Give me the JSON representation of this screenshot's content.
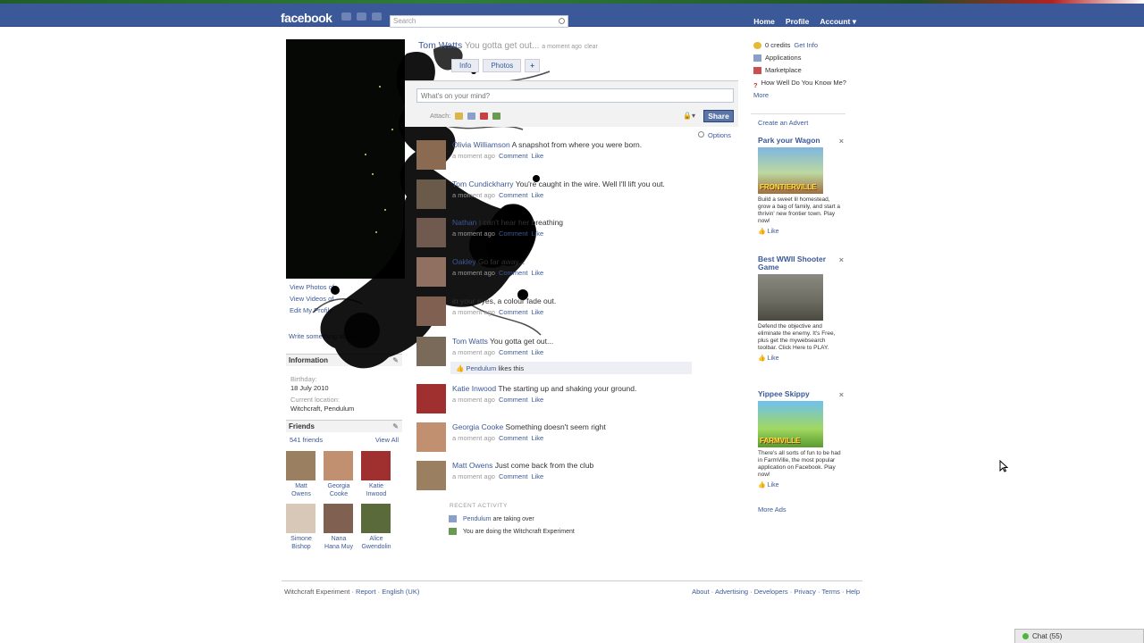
{
  "brand": {
    "logo": "facebook"
  },
  "header": {
    "search_placeholder": "Search",
    "nav": [
      "Home",
      "Profile",
      "Account ▾"
    ]
  },
  "colors": {
    "brand_blue": "#3b5998",
    "link": "#3b5998",
    "share": "#5b74a8"
  },
  "profile": {
    "name": "Tom Watts",
    "status": "You gotta get out...",
    "status_time": "a moment ago",
    "clear": "clear",
    "tabs": [
      "Info",
      "Photos",
      "+"
    ]
  },
  "left": {
    "links": [
      "View Photos of",
      "View Videos of",
      "Edit My Profile"
    ],
    "write_about": "Write something about",
    "info_title": "Information",
    "birthday_label": "Birthday:",
    "birthday": "18 July 2010",
    "location_label": "Current location:",
    "location": "Witchcraft, Pendulum",
    "friends_title": "Friends",
    "friends_count": "541 friends",
    "view_all": "View All",
    "friends": [
      {
        "first": "Matt",
        "last": "Owens",
        "color": "#9a8060"
      },
      {
        "first": "Georgia",
        "last": "Cooke",
        "color": "#c09070"
      },
      {
        "first": "Katie",
        "last": "Inwood",
        "color": "#a03030"
      },
      {
        "first": "Simone",
        "last": "Bishop",
        "color": "#d8c8b8"
      },
      {
        "first": "Nana",
        "last": "Hana Muy",
        "color": "#806050"
      },
      {
        "first": "Alice",
        "last": "Gwendolin",
        "color": "#5a6a3a"
      }
    ]
  },
  "composer": {
    "placeholder": "What's on your mind?",
    "attach_label": "Attach:",
    "share": "Share",
    "options": "Options"
  },
  "feed": [
    {
      "who": "Olivia Williamson",
      "text": "A snapshot from where you were born.",
      "color": "#8a6a50"
    },
    {
      "who": "Tom Cundickharry",
      "text": "You're caught in the wire. Well I'll lift you out.",
      "color": "#6a5a4a"
    },
    {
      "who": "Nathan",
      "text": "I can't hear her breathing",
      "color": "#705a50"
    },
    {
      "who": "Oakley",
      "text": "Go far away...",
      "color": "#907060"
    },
    {
      "who": "",
      "text": "in your eyes, a colour fade out.",
      "color": "#806050"
    },
    {
      "who": "Tom Watts",
      "text": "You gotta get out...",
      "color": "#7a6a5a"
    },
    {
      "who": "Katie Inwood",
      "text": "The starting up and shaking your ground.",
      "color": "#a03030"
    },
    {
      "who": "Georgia Cooke",
      "text": "Something doesn't seem right",
      "color": "#c09070"
    },
    {
      "who": "Matt Owens",
      "text": "Just come back from the club",
      "color": "#9a8060"
    }
  ],
  "feed_meta": {
    "time": "a moment ago",
    "comment": "Comment",
    "like": "Like"
  },
  "likes_bar": {
    "who": "Pendulum",
    "text": "likes this"
  },
  "recent": {
    "title": "RECENT ACTIVITY",
    "items": [
      {
        "who": "Pendulum",
        "text": "are taking over"
      },
      {
        "who": "",
        "text": "You are doing the Witchcraft Experiment"
      }
    ]
  },
  "right": {
    "credits": "0 credits",
    "get_info": "Get Info",
    "applications": "Applications",
    "marketplace": "Marketplace",
    "quiz": "How Well Do You Know Me?",
    "more": "More",
    "create_advert": "Create an Advert",
    "ads": [
      {
        "title": "Park your Wagon",
        "body": "Build a sweet lil homestead, grow a bag of family, and start a thrivin' new frontier town. Play now!",
        "like": "Like",
        "brand": "FRONTIERVILLE"
      },
      {
        "title": "Best WWII Shooter Game",
        "body": "Defend the objective and eliminate the enemy. It's Free, plus get the mywebsearch toolbar. Click Here to PLAY.",
        "like": "Like",
        "brand": ""
      },
      {
        "title": "Yippee Skippy",
        "body": "There's all sorts of fun to be had in FarmVille, the most popular application on Facebook. Play now!",
        "like": "Like",
        "brand": "FARMVILLE"
      }
    ],
    "more_ads": "More Ads"
  },
  "footer": {
    "left": [
      "Witchcraft Experiment",
      "Report",
      "English (UK)"
    ],
    "right": [
      "About",
      "Advertising",
      "Developers",
      "Privacy",
      "Terms",
      "Help"
    ]
  },
  "chat": {
    "label": "Chat (55)"
  }
}
